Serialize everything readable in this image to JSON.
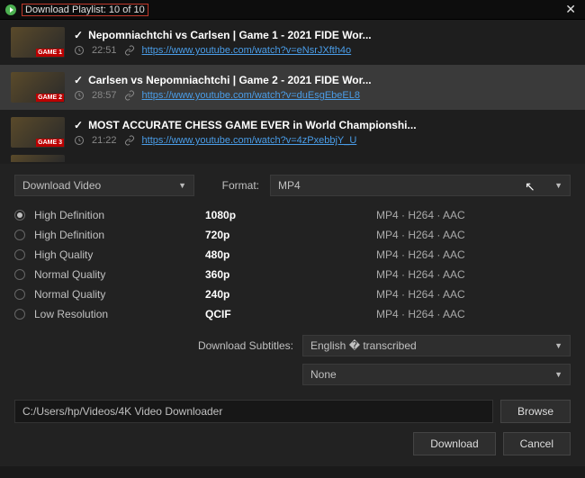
{
  "titlebar": {
    "title": "Download Playlist: 10 of 10"
  },
  "playlist": [
    {
      "badge": "GAME 1",
      "title": "Nepomniachtchi vs Carlsen | Game 1 - 2021 FIDE Wor...",
      "duration": "22:51",
      "url": "https://www.youtube.com/watch?v=eNsrJXfth4o"
    },
    {
      "badge": "GAME 2",
      "title": "Carlsen vs Nepomniachtchi | Game 2 - 2021 FIDE Wor...",
      "duration": "28:57",
      "url": "https://www.youtube.com/watch?v=duEsgEbeEL8"
    },
    {
      "badge": "GAME 3",
      "title": "MOST ACCURATE CHESS GAME EVER in World Championshi...",
      "duration": "21:22",
      "url": "https://www.youtube.com/watch?v=4zPxebbjY_U"
    }
  ],
  "controls": {
    "action_dropdown": "Download Video",
    "format_label": "Format:",
    "format_value": "MP4"
  },
  "quality_options": [
    {
      "name": "High Definition",
      "res": "1080p",
      "codec": "MP4 · H264 · AAC",
      "selected": true
    },
    {
      "name": "High Definition",
      "res": "720p",
      "codec": "MP4 · H264 · AAC",
      "selected": false
    },
    {
      "name": "High Quality",
      "res": "480p",
      "codec": "MP4 · H264 · AAC",
      "selected": false
    },
    {
      "name": "Normal Quality",
      "res": "360p",
      "codec": "MP4 · H264 · AAC",
      "selected": false
    },
    {
      "name": "Normal Quality",
      "res": "240p",
      "codec": "MP4 · H264 · AAC",
      "selected": false
    },
    {
      "name": "Low Resolution",
      "res": "QCIF",
      "codec": "MP4 · H264 · AAC",
      "selected": false
    }
  ],
  "subtitles": {
    "label": "Download Subtitles:",
    "value1": "English � transcribed",
    "value2": "None"
  },
  "path": {
    "value": "C:/Users/hp/Videos/4K Video Downloader",
    "browse": "Browse"
  },
  "actions": {
    "download": "Download",
    "cancel": "Cancel"
  }
}
